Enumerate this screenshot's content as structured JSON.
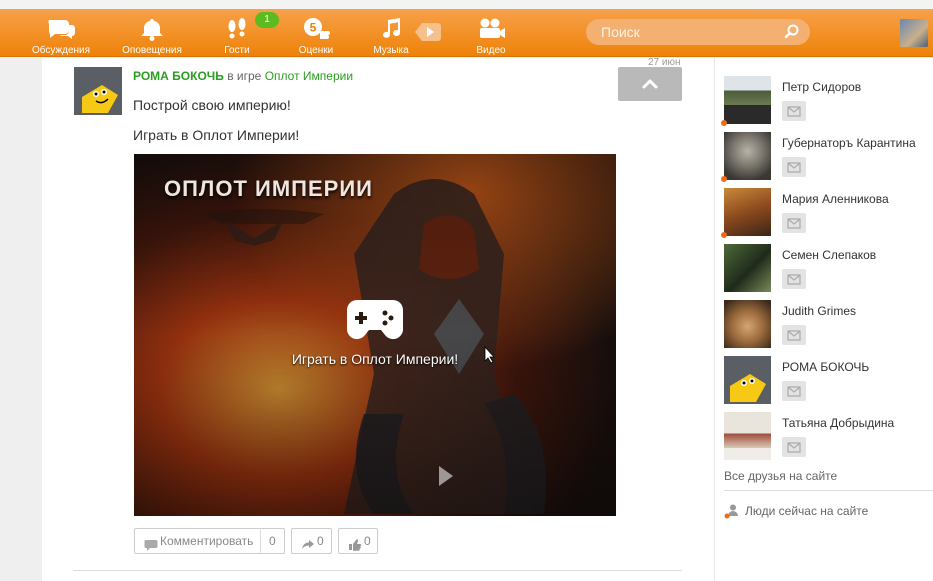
{
  "nav": {
    "items": [
      {
        "label": "Обсуждения",
        "icon": "chat-bubbles-icon"
      },
      {
        "label": "Оповещения",
        "icon": "bell-icon"
      },
      {
        "label": "Гости",
        "icon": "footprints-icon"
      },
      {
        "label": "Оценки",
        "icon": "rating-five-icon"
      },
      {
        "label": "Музыка",
        "icon": "music-note-icon"
      },
      {
        "label": "Видео",
        "icon": "video-camera-icon"
      }
    ],
    "guests_badge": "1",
    "search_placeholder": "Поиск"
  },
  "post": {
    "date": "27 июн",
    "author": "РОМА БОКОЧЬ",
    "in_game": "в игре",
    "game": "Оплот Империи",
    "text1": "Построй свою империю!",
    "text2": "Играть в Оплот Империи!",
    "banner_title": "ОПЛОТ ИМПЕРИИ",
    "play_label": "Играть в Оплот Империи!",
    "actions": {
      "comment_label": "Комментировать",
      "comment_count": "0",
      "share_count": "0",
      "like_count": "0"
    }
  },
  "sidebar": {
    "friends": [
      {
        "name": "Петр Сидоров",
        "online": true
      },
      {
        "name": "Губернаторъ Карантина",
        "online": true
      },
      {
        "name": "Мария Аленникова",
        "online": true
      },
      {
        "name": "Семен Слепаков",
        "online": false
      },
      {
        "name": "Judith Grimes",
        "online": false
      },
      {
        "name": "РОМА БОКОЧЬ",
        "online": false
      },
      {
        "name": "Татьяна Добрыдина",
        "online": false
      }
    ],
    "all_friends_label": "Все друзья на сайте",
    "people_now_label": "Люди сейчас на сайте"
  },
  "colors": {
    "brand_orange": "#ee8208",
    "accent_green": "#2a9e20",
    "online_dot": "#f06a1a"
  }
}
